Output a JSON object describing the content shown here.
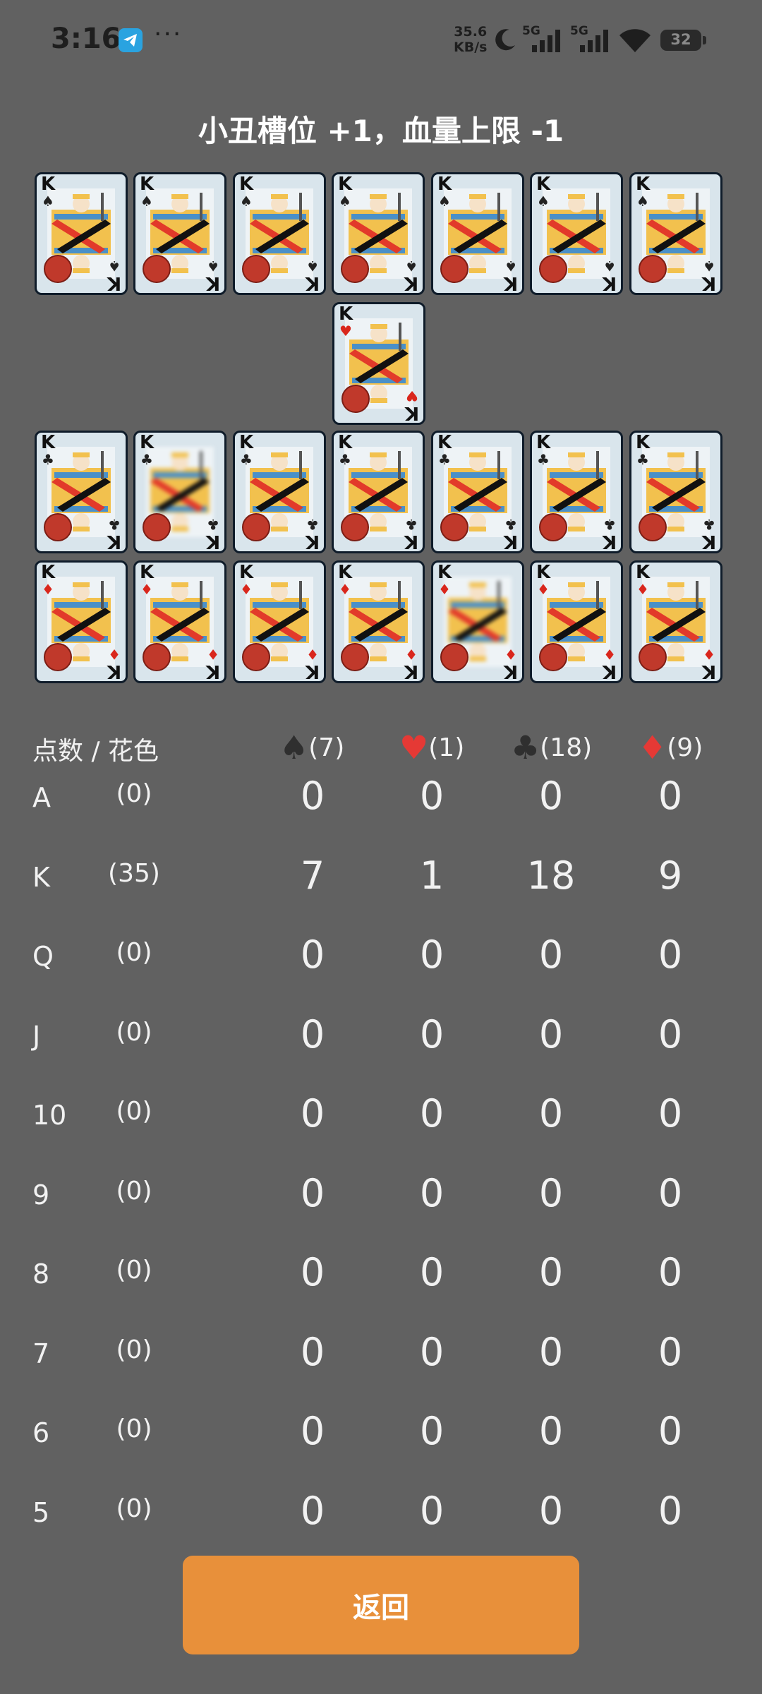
{
  "status_bar": {
    "time": "3:16",
    "dots": "···",
    "speed_value": "35.6",
    "speed_unit": "KB/s",
    "net1": "5G",
    "net2": "5G",
    "battery": "32",
    "icons": [
      "telegram-icon",
      "moon-icon",
      "signal-icon",
      "wifi-icon",
      "battery-icon"
    ]
  },
  "title": "小丑槽位 +1，血量上限 -1",
  "cards": {
    "rows": [
      {
        "suit_symbol": "♠",
        "color": "#222222",
        "ranks": [
          "K",
          "K",
          "K",
          "K",
          "K",
          "K",
          "K"
        ]
      },
      {
        "suit_symbol": "♥",
        "color": "#d9261c",
        "ranks": [
          "K"
        ]
      },
      {
        "suit_symbol": "♣",
        "color": "#222222",
        "ranks": [
          "K",
          "K",
          "K",
          "K",
          "K",
          "K",
          "K"
        ]
      },
      {
        "suit_symbol": "♦",
        "color": "#d9261c",
        "ranks": [
          "K",
          "K",
          "K",
          "K",
          "K",
          "K",
          "K"
        ]
      }
    ]
  },
  "stats": {
    "header_label": "点数 / 花色",
    "suits": [
      {
        "symbol": "♠",
        "count": "(7)",
        "color": "#2f2f2f"
      },
      {
        "symbol": "♥",
        "count": "(1)",
        "color": "#e53935"
      },
      {
        "symbol": "♣",
        "count": "(18)",
        "color": "#2f2f2f"
      },
      {
        "symbol": "♦",
        "count": "(9)",
        "color": "#e53935"
      }
    ],
    "rows": [
      {
        "rank": "A",
        "total": "(0)",
        "values": [
          "0",
          "0",
          "0",
          "0"
        ]
      },
      {
        "rank": "K",
        "total": "(35)",
        "values": [
          "7",
          "1",
          "18",
          "9"
        ]
      },
      {
        "rank": "Q",
        "total": "(0)",
        "values": [
          "0",
          "0",
          "0",
          "0"
        ]
      },
      {
        "rank": "J",
        "total": "(0)",
        "values": [
          "0",
          "0",
          "0",
          "0"
        ]
      },
      {
        "rank": "10",
        "total": "(0)",
        "values": [
          "0",
          "0",
          "0",
          "0"
        ]
      },
      {
        "rank": "9",
        "total": "(0)",
        "values": [
          "0",
          "0",
          "0",
          "0"
        ]
      },
      {
        "rank": "8",
        "total": "(0)",
        "values": [
          "0",
          "0",
          "0",
          "0"
        ]
      },
      {
        "rank": "7",
        "total": "(0)",
        "values": [
          "0",
          "0",
          "0",
          "0"
        ]
      },
      {
        "rank": "6",
        "total": "(0)",
        "values": [
          "0",
          "0",
          "0",
          "0"
        ]
      },
      {
        "rank": "5",
        "total": "(0)",
        "values": [
          "0",
          "0",
          "0",
          "0"
        ]
      }
    ]
  },
  "back_button": "返回",
  "colors": {
    "background": "#616161",
    "button": "#e8903a",
    "card_border": "#0f1c2a"
  }
}
